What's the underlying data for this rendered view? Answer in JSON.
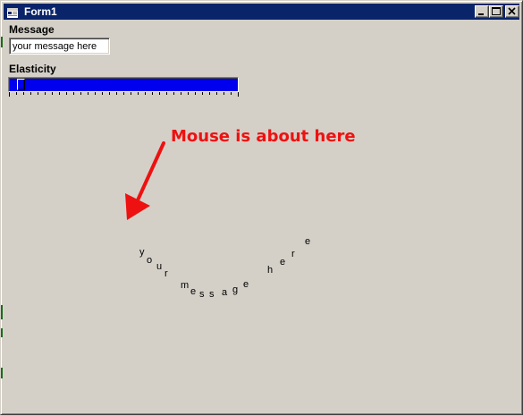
{
  "window": {
    "title": "Form1"
  },
  "controls": {
    "message_label": "Message",
    "message_value": "your message here",
    "elasticity_label": "Elasticity",
    "elasticity_value": 0.03
  },
  "annotation": {
    "text": "Mouse is about here"
  },
  "canvas": {
    "curved_text": [
      "y",
      "o",
      "u",
      "r",
      "m",
      "e",
      "s",
      "s",
      "a",
      "g",
      "e",
      "h",
      "e",
      "r",
      "e"
    ]
  },
  "colors": {
    "title_bar": "#0a246a",
    "window_face": "#d4d0c8",
    "slider_fill": "#0000ee",
    "annotation": "#ee1111"
  },
  "icons": [
    "form-icon",
    "minimize-icon",
    "maximize-icon",
    "close-icon",
    "arrow-icon"
  ]
}
